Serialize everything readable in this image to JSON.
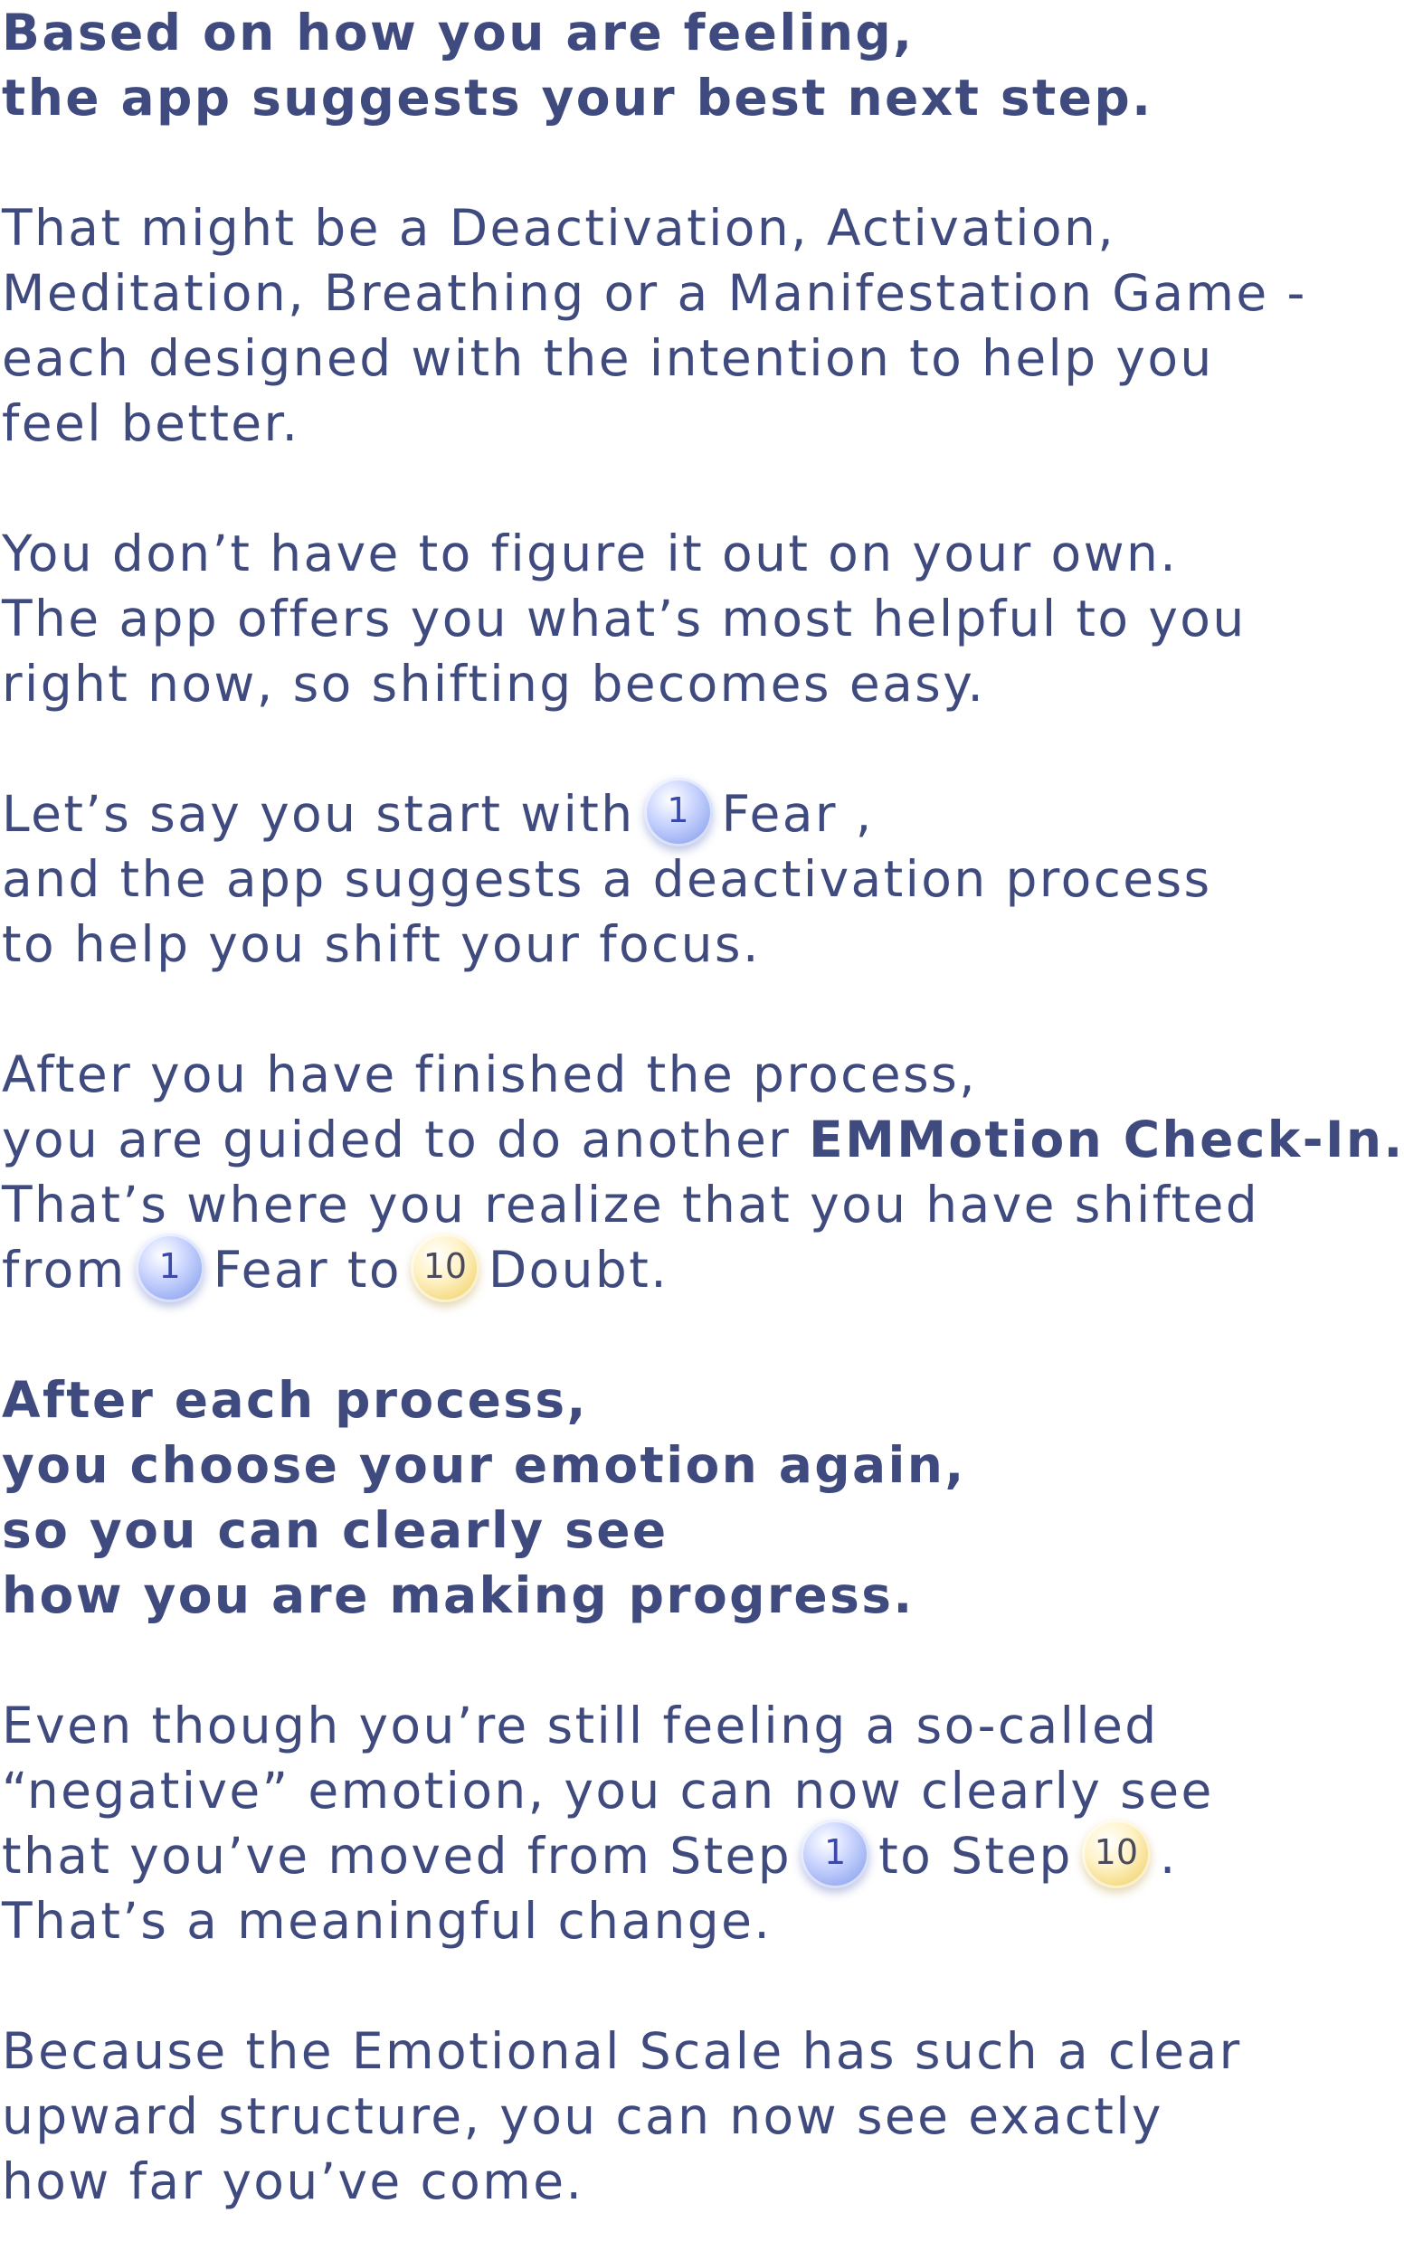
{
  "paragraphs": {
    "intro": {
      "line1": "Based on how you are feeling,",
      "line2": "the app suggests your best next step."
    },
    "options": {
      "line1": "That might be a Deactivation, Activation,",
      "line2": "Meditation, Breathing or a Manifestation Game -",
      "line3": "each designed with the intention to help you",
      "line4": "feel better."
    },
    "own": {
      "line1": "You don’t have to figure it out on your own.",
      "line2": "The app offers you what’s most helpful to you",
      "line3": "right now, so shifting becomes easy."
    },
    "example": {
      "line1_pre": "Let’s say you start with",
      "badge_1": "1",
      "line1_post": "Fear ,",
      "line2": "and the app suggests a deactivation process",
      "line3": "to help you shift your focus."
    },
    "after": {
      "line1": "After you have finished the process,",
      "line2_pre": "you are guided to do another",
      "line2_bold": "EMMotion Check-In.",
      "line3": "That’s where you realize that you have shifted",
      "line4_pre": "from",
      "badge_1": "1",
      "line4_mid": "Fear to",
      "badge_10": "10",
      "line4_post": "Doubt."
    },
    "each": {
      "line1": "After each process,",
      "line2": "you choose your emotion again,",
      "line3": "so you can clearly see",
      "line4": "how you are making progress."
    },
    "even": {
      "line1": "Even though you’re still feeling a so-called",
      "line2": "“negative” emotion, you can now clearly see",
      "line3_pre": "that you’ve moved from Step",
      "badge_1": "1",
      "line3_mid": "to Step",
      "badge_10": "10",
      "line3_post": ".",
      "line4": "That’s a meaningful change."
    },
    "scale": {
      "line1": "Because the Emotional Scale has such a clear",
      "line2": "upward structure, you can now see exactly",
      "line3": "how far you’ve come."
    }
  },
  "colors": {
    "text": "#3f4a7e",
    "badge_blue": "#9fb2f3",
    "badge_gold": "#f5dc87"
  }
}
